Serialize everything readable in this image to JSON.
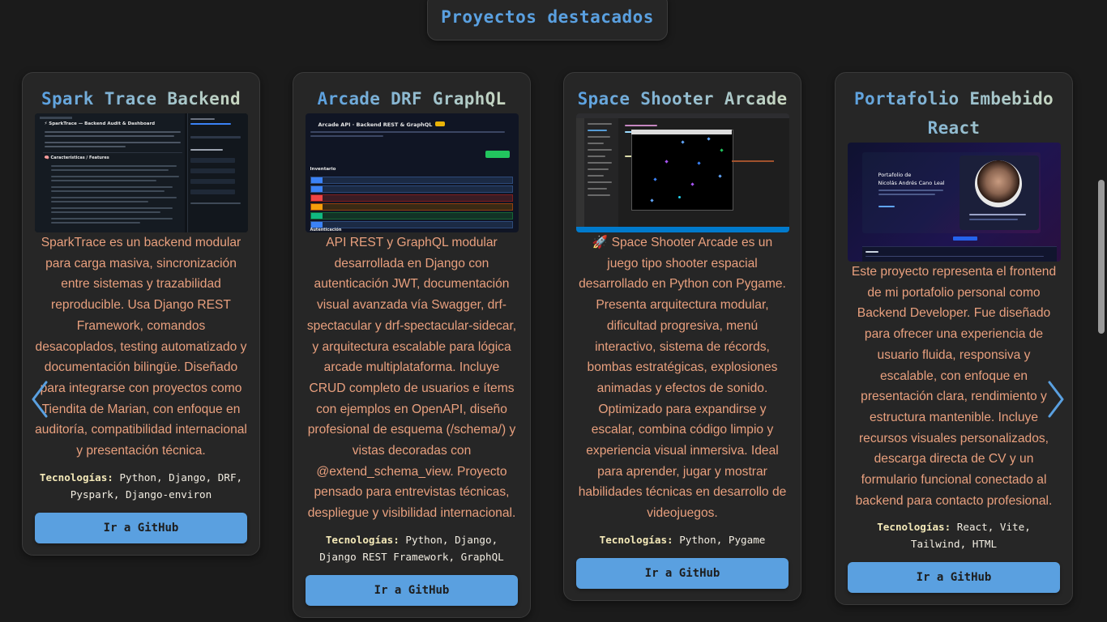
{
  "section": {
    "title": "Proyectos destacados"
  },
  "projects": [
    {
      "title": "Spark Trace Backend",
      "screenshot_icon": "dashboard-screenshot",
      "description": "SparkTrace es un backend modular para carga masiva, sincronización entre sistemas y trazabilidad reproducible. Usa Django REST Framework, comandos desacoplados, testing automatizado y documentación bilingüe. Diseñado para integrarse con proyectos como Tiendita de Marian, con enfoque en auditoría, compatibilidad internacional y presentación técnica.",
      "tech_label": "Tecnologías:",
      "tech": "Python, Django, DRF, Pyspark, Django-environ",
      "button": "Ir a GitHub"
    },
    {
      "title": "Arcade DRF GraphQL",
      "screenshot_icon": "swagger-screenshot",
      "description": "API REST y GraphQL modular desarrollada en Django con autenticación JWT, documentación visual avanzada vía Swagger, drf-spectacular y drf-spectacular-sidecar, y arquitectura escalable para lógica arcade multiplataforma. Incluye CRUD completo de usuarios e ítems con ejemplos en OpenAPI, diseño profesional de esquema (/schema/) y vistas decoradas con @extend_schema_view. Proyecto pensado para entrevistas técnicas, despliegue y visibilidad internacional.",
      "tech_label": "Tecnologías:",
      "tech": "Python, Django, Django REST Framework, GraphQL",
      "button": "Ir a GitHub"
    },
    {
      "title": "Space Shooter Arcade",
      "screenshot_icon": "game-screenshot",
      "description": "🚀 Space Shooter Arcade es un juego tipo shooter espacial desarrollado en Python con Pygame. Presenta arquitectura modular, dificultad progresiva, menú interactivo, sistema de récords, bombas estratégicas, explosiones animadas y efectos de sonido. Optimizado para expandirse y escalar, combina código limpio y experiencia visual inmersiva. Ideal para aprender, jugar y mostrar habilidades técnicas en desarrollo de videojuegos.",
      "tech_label": "Tecnologías:",
      "tech": "Python, Pygame",
      "button": "Ir a GitHub"
    },
    {
      "title": "Portafolio Embebido React",
      "screenshot_icon": "portfolio-screenshot",
      "description": "Este proyecto representa el frontend de mi portafolio personal como Backend Developer. Fue diseñado para ofrecer una experiencia de usuario fluida, responsiva y escalable, con enfoque en presentación clara, rendimiento y estructura mantenible. Incluye recursos visuales personalizados, descarga directa de CV y un formulario funcional conectado al backend para contacto profesional.",
      "tech_label": "Tecnologías:",
      "tech": "React, Vite, Tailwind, HTML",
      "button": "Ir a GitHub"
    }
  ],
  "screenshots": {
    "spark": {
      "heading": "⚡ SparkTrace — Backend Audit & Dashboard",
      "section": "🧠 Características / Features"
    },
    "arcade": {
      "heading": "Arcade API · Backend REST & GraphQL",
      "section": "Inventario",
      "section2": "Autenticación"
    },
    "portfolio": {
      "line1": "Portafolio de",
      "line2": "Nicolás Andrés Cano Leal"
    }
  },
  "nav": {
    "prev_icon": "chevron-left-icon",
    "next_icon": "chevron-right-icon"
  },
  "colors": {
    "accent": "#5aa0e0",
    "description": "#e9a07e",
    "background": "#1b1b1b",
    "card": "#262626"
  }
}
